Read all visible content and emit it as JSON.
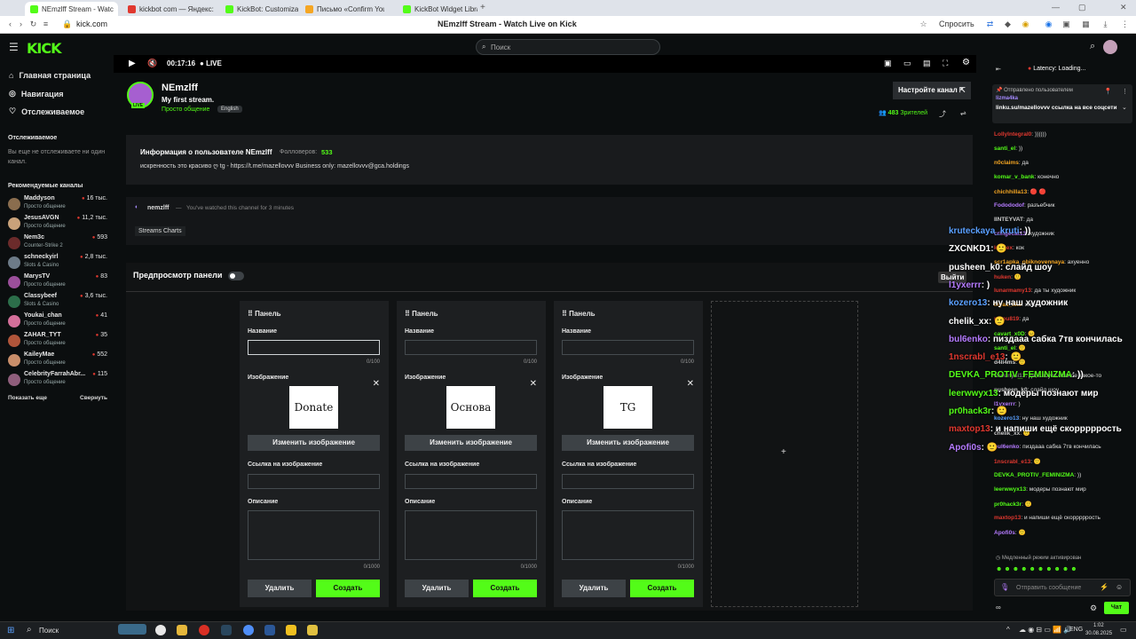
{
  "browser": {
    "tabs": [
      {
        "title": "NEmzlff Stream - Watc",
        "color": "#53fc18"
      },
      {
        "title": "kickbot com — Яндекс: на",
        "color": "#e0382f"
      },
      {
        "title": "KickBot: Customizable Ch",
        "color": "#53fc18"
      },
      {
        "title": "Письмо «Confirm Your Si",
        "color": "#f5a623"
      },
      {
        "title": "KickBot Widget Library",
        "color": "#53fc18"
      }
    ],
    "url": "kick.com",
    "page_title": "NEmzlff Stream - Watch Live on Kick",
    "ask_label": "Спросить"
  },
  "header": {
    "logo": "KICK",
    "search_placeholder": "Поиск"
  },
  "sidebar": {
    "nav": [
      {
        "label": "Главная страница",
        "icon": "home-icon"
      },
      {
        "label": "Навигация",
        "icon": "compass-icon"
      },
      {
        "label": "Отслеживаемое",
        "icon": "heart-icon"
      }
    ],
    "following_title": "Отслеживаемое",
    "following_empty": "Вы еще не отслеживаете ни один канал.",
    "recommended_title": "Рекомендуемые каналы",
    "channels": [
      {
        "name": "Maddyson",
        "category": "Просто общение",
        "viewers": "16 тыс.",
        "color": "#8a6d4e"
      },
      {
        "name": "JesusAVGN",
        "category": "Просто общение",
        "viewers": "11,2 тыс.",
        "color": "#c9a27a"
      },
      {
        "name": "Nem3c",
        "category": "Counter-Strike 2",
        "viewers": "593",
        "color": "#6b2b2b"
      },
      {
        "name": "schneckyirl",
        "category": "Slots & Casino",
        "viewers": "2,8 тыс.",
        "color": "#6d7b88"
      },
      {
        "name": "MarysTV",
        "category": "Просто общение",
        "viewers": "83",
        "color": "#9b4f9b"
      },
      {
        "name": "Classybeef",
        "category": "Slots & Casino",
        "viewers": "3,6 тыс.",
        "color": "#2c6e4a"
      },
      {
        "name": "Youkai_chan",
        "category": "Просто общение",
        "viewers": "41",
        "color": "#d46f9a"
      },
      {
        "name": "ZAHAR_TYT",
        "category": "Просто общение",
        "viewers": "35",
        "color": "#b0553a"
      },
      {
        "name": "KaileyMae",
        "category": "Просто общение",
        "viewers": "552",
        "color": "#c98e6a"
      },
      {
        "name": "CelebrityFarrahAbr...",
        "category": "Просто общение",
        "viewers": "115",
        "color": "#8f5e7c"
      }
    ],
    "show_more": "Показать еще",
    "collapse": "Свернуть"
  },
  "player": {
    "time": "00:17:16",
    "live": "LIVE"
  },
  "channel": {
    "name": "NEmzlff",
    "title": "My first stream.",
    "category": "Просто общение",
    "language": "English",
    "live_badge": "LIVE",
    "setup_button": "Настройте канал",
    "viewers_count": "483",
    "viewers_label": "Зрителей"
  },
  "about": {
    "title": "Информация о пользователе NEmzlff",
    "followers_label": "Фолловеров:",
    "followers_count": "533",
    "bio": "искренность это красиво ღ tg - https://t.me/mazellovvv Business only: mazellovvv@gca.holdings"
  },
  "watched": {
    "user": "nemzlff",
    "sep": "—",
    "text": "You've watched this channel for 3 minutes",
    "tag": "Streams Charts"
  },
  "panels_section": {
    "title": "Предпросмотр панели",
    "add_symbol": "+",
    "panels": [
      {
        "header": "Панель",
        "name_label": "Название",
        "name_count": "0/100",
        "image_label": "Изображение",
        "image_text": "Donate",
        "change_label": "Изменить изображение",
        "link_label": "Ссылка на изображение",
        "desc_label": "Описание",
        "desc_count": "0/1000",
        "delete_label": "Удалить",
        "create_label": "Создать"
      },
      {
        "header": "Панель",
        "name_label": "Название",
        "name_count": "0/100",
        "image_label": "Изображение",
        "image_text": "Основа",
        "change_label": "Изменить изображение",
        "link_label": "Ссылка на изображение",
        "desc_label": "Описание",
        "desc_count": "0/1000",
        "delete_label": "Удалить",
        "create_label": "Создать"
      },
      {
        "header": "Панель",
        "name_label": "Название",
        "name_count": "0/100",
        "image_label": "Изображение",
        "image_text": "TG",
        "change_label": "Изменить изображение",
        "link_label": "Ссылка на изображение",
        "desc_label": "Описание",
        "desc_count": "0/1000",
        "delete_label": "Удалить",
        "create_label": "Создать"
      }
    ]
  },
  "chat": {
    "latency": "Latency: Loading...",
    "pinned_by": "Отправлено пользователем",
    "pinned_user": "lizma4ka",
    "pinned_text": "linku.su/mazellovvv ссылка на все соцсети",
    "messages": [
      {
        "user": "LollyIntegral0",
        "text": "))))))",
        "color": "#e0382f"
      },
      {
        "user": "santi_el",
        "text": "))",
        "color": "#53fc18"
      },
      {
        "user": "n0claims",
        "text": "да",
        "color": "#f5a623"
      },
      {
        "user": "komar_v_bank",
        "text": "конечно",
        "color": "#53fc18"
      },
      {
        "user": "chichhilla13",
        "text": "🔴 🔴",
        "color": "#f5a623"
      },
      {
        "user": "Fodododof",
        "text": "разъебчик",
        "color": "#b57bff"
      },
      {
        "user": "IINTEYVAT",
        "text": "да",
        "color": "#cccccc"
      },
      {
        "user": "cringecat13",
        "text": "художник",
        "color": "#b57bff"
      },
      {
        "user": "koffiex",
        "text": "кок",
        "color": "#e0382f"
      },
      {
        "user": "scr1apka_obiknovennaya",
        "text": "ахуенно",
        "color": "#f5a623"
      },
      {
        "user": "huken",
        "text": "🙂",
        "color": "#e0382f"
      },
      {
        "user": "lunarmamy13",
        "text": "да ты художник",
        "color": "#e0382f"
      },
      {
        "user": "myas_kke",
        "text": "жес",
        "color": "#f5a623"
      },
      {
        "user": "nikou819",
        "text": "да",
        "color": "#e0382f"
      },
      {
        "user": "cavart_x0D",
        "text": "😐",
        "color": "#53fc18"
      },
      {
        "user": "santi_el",
        "text": "🙂",
        "color": "#53fc18"
      },
      {
        "user": "d4ll4ms",
        "text": "🙂",
        "color": "#cccccc"
      },
      {
        "user": "fowunysi13",
        "text": "да, слоуко ебаное какое-то",
        "color": "#888888"
      },
      {
        "user": "pusheen_k0",
        "text": "слайд шоу",
        "color": "#cccccc"
      },
      {
        "user": "l1yxerrr",
        "text": ")",
        "color": "#b57bff"
      },
      {
        "user": "kozero13",
        "text": "ну наш художник",
        "color": "#5aa0ff"
      },
      {
        "user": "chelik_xx",
        "text": "🙂",
        "color": "#cccccc"
      },
      {
        "user": "bul6enko",
        "text": "пиздааа сабка 7тв кончилась",
        "color": "#b57bff"
      },
      {
        "user": "1nscrabl_e13",
        "text": "🙂",
        "color": "#e0382f"
      },
      {
        "user": "DEVKA_PROTIV_FEMINIZMA",
        "text": "))",
        "color": "#53fc18"
      },
      {
        "user": "leerwwyx13",
        "text": "модеры познают мир",
        "color": "#53fc18"
      },
      {
        "user": "pr0hack3r",
        "text": "🙂",
        "color": "#53fc18"
      },
      {
        "user": "maxtop13",
        "text": "и напиши ещё скорррррость",
        "color": "#e0382f"
      },
      {
        "user": "Apofi0s",
        "text": "🙂",
        "color": "#b57bff"
      }
    ],
    "slow_mode": "Медленный режим активирован",
    "input_placeholder": "Отправить сообщение",
    "send_label": "Чат",
    "loop_symbol": "∞"
  },
  "overlay": {
    "exit_label": "Выйти",
    "messages": [
      {
        "user": "kruteckaya_kruti",
        "text": "))",
        "color": "#5aa0ff"
      },
      {
        "user": "ZXCNKD1",
        "text": "🙂",
        "color": "#ffffff"
      },
      {
        "user": "pusheen_k0",
        "text": "слайд шоу",
        "color": "#ffffff"
      },
      {
        "user": "l1yxerrr",
        "text": ")",
        "color": "#b57bff"
      },
      {
        "user": "kozero13",
        "text": "ну наш художник",
        "color": "#5aa0ff"
      },
      {
        "user": "chelik_xx",
        "text": "🙂",
        "color": "#ffffff"
      },
      {
        "user": "bul6enko",
        "text": "пиздааа сабка 7тв кончилась",
        "color": "#b57bff"
      },
      {
        "user": "1nscrabl_e13",
        "text": "🙂",
        "color": "#e0382f"
      },
      {
        "user": "DEVKA_PROTIV_FEMINIZMA",
        "text": "))",
        "color": "#53fc18"
      },
      {
        "user": "leerwwyx13",
        "text": "модеры познают мир",
        "color": "#53fc18"
      },
      {
        "user": "pr0hack3r",
        "text": "🙂",
        "color": "#53fc18"
      },
      {
        "user": "maxtop13",
        "text": "и напиши ещё скорррррость",
        "color": "#e0382f"
      },
      {
        "user": "Apofi0s",
        "text": "🙂",
        "color": "#b57bff"
      }
    ]
  },
  "taskbar": {
    "search_label": "Поиск",
    "lang": "ENG",
    "time": "1:02",
    "date": "30.08.2025"
  },
  "colors": {
    "accent": "#53fc18",
    "bg": "#0b0e0f"
  }
}
